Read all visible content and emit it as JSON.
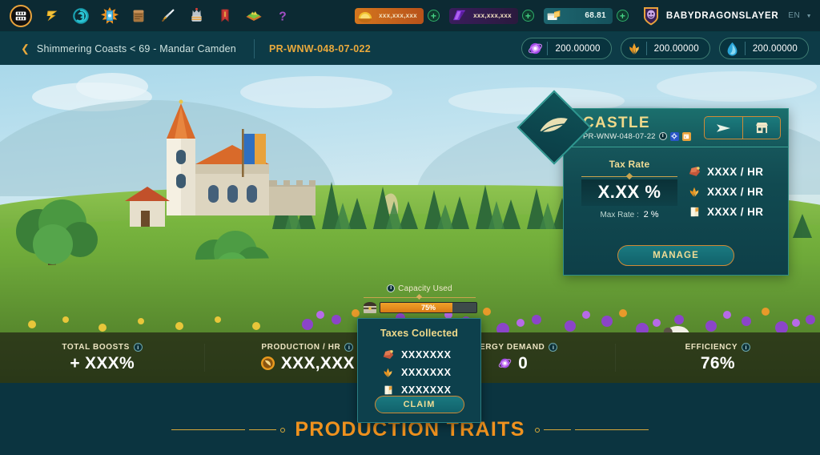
{
  "topnav": {
    "icons": [
      {
        "name": "logo-icon",
        "label": "Logo"
      },
      {
        "name": "lightning-icon",
        "label": "Energy"
      },
      {
        "name": "spiral-icon",
        "label": "Portal"
      },
      {
        "name": "card-pack-icon",
        "label": "Packs"
      },
      {
        "name": "scroll-icon",
        "label": "Quests"
      },
      {
        "name": "sword-icon",
        "label": "Battle"
      },
      {
        "name": "crown-icon",
        "label": "Ranked"
      },
      {
        "name": "banner-icon",
        "label": "Guild"
      },
      {
        "name": "land-icon",
        "label": "Lands"
      },
      {
        "name": "help-icon",
        "label": "Help"
      }
    ],
    "currencies": [
      {
        "name": "credits",
        "value": "xxx,xxx,xxx",
        "color": "#d4761e"
      },
      {
        "name": "dec",
        "value": "xxx,xxx,xxx",
        "color": "#3a1d5c"
      },
      {
        "name": "voucher",
        "value": "68.81",
        "color": "#1d6670"
      }
    ],
    "add_label": "+",
    "username": "BABYDRAGONSLAYER",
    "language": "EN"
  },
  "breadcrumb": {
    "back_label": "❮",
    "trail": "Shimmering Coasts < 69 - Mandar Camden",
    "code": "PR-WNW-048-07-022",
    "resources": [
      {
        "name": "research",
        "value": "200.00000"
      },
      {
        "name": "grain",
        "value": "200.00000"
      },
      {
        "name": "aura",
        "value": "200.00000"
      }
    ]
  },
  "castle_panel": {
    "title": "CASTLE",
    "code": "PR-WNW-048-07-22",
    "info_label": "i",
    "actions": [
      {
        "name": "send-button",
        "icon": "send-icon"
      },
      {
        "name": "market-button",
        "icon": "market-icon"
      }
    ],
    "tax": {
      "label": "Tax Rate",
      "value": "X.XX %",
      "max_label": "Max Rate :",
      "max_value": "2 %"
    },
    "rates": [
      {
        "icon": "stone-icon",
        "text": "XXXX / HR"
      },
      {
        "icon": "grain-icon",
        "text": "XXXX / HR"
      },
      {
        "icon": "parchment-icon",
        "text": "XXXX / HR"
      }
    ],
    "manage_label": "MANAGE"
  },
  "capacity": {
    "title": "Capacity Used",
    "info_label": "i",
    "percent_label": "75%",
    "percent_value": 75
  },
  "taxes_popup": {
    "title": "Taxes Collected",
    "rows": [
      {
        "icon": "stone-icon",
        "value": "XXXXXXX"
      },
      {
        "icon": "grain-icon",
        "value": "XXXXXXX"
      },
      {
        "icon": "parchment-icon",
        "value": "XXXXXXX"
      }
    ],
    "claim_label": "CLAIM"
  },
  "stats": [
    {
      "label": "TOTAL BOOSTS",
      "info": "i",
      "value": "+ XXX%",
      "icon": null
    },
    {
      "label": "PRODUCTION / HR",
      "info": "i",
      "value": "XXX,XXX",
      "icon": "production-icon"
    },
    {
      "label": "ENERGY DEMAND",
      "info": "i",
      "value": "0",
      "icon": "energy-icon"
    },
    {
      "label": "EFFICIENCY",
      "info": "i",
      "value": "76%",
      "icon": null
    }
  ],
  "bottom": {
    "traits_title": "PRODUCTION TRAITS"
  },
  "colors": {
    "accent_gold": "#e9a93c",
    "panel_teal": "#11626b",
    "orange_title": "#f0921e",
    "bar_orange": "#e88f1e"
  }
}
